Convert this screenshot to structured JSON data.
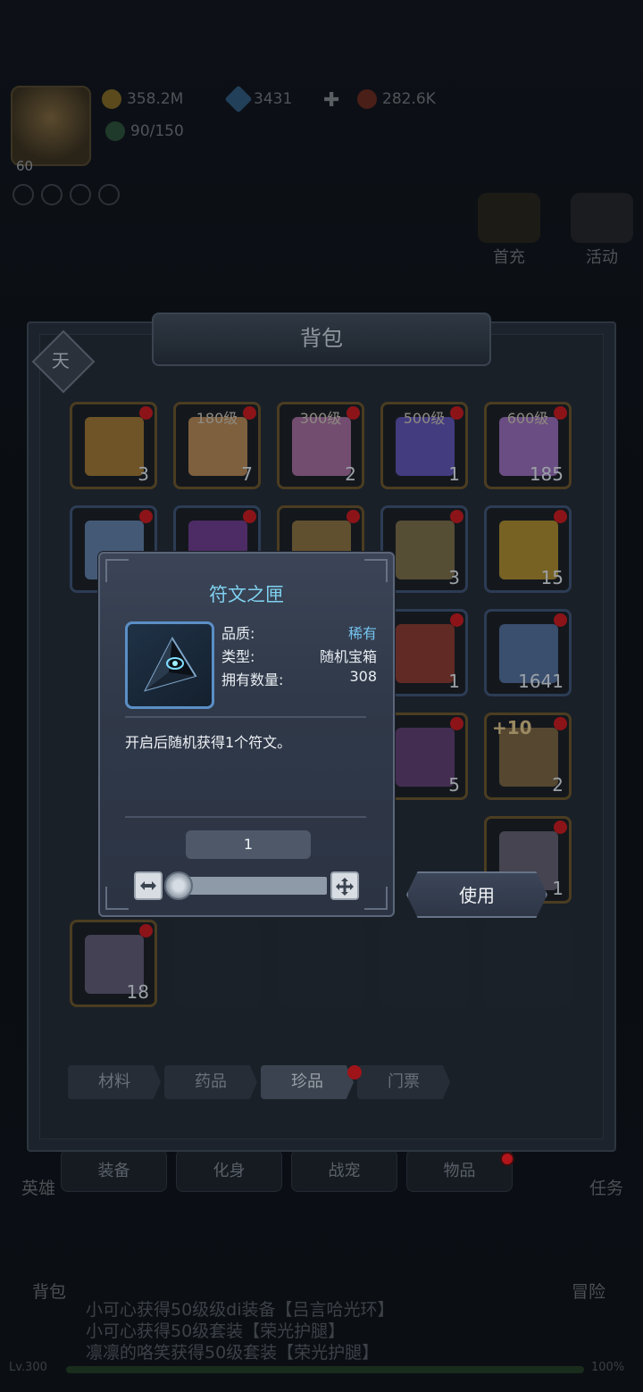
{
  "hud": {
    "player_level": "60",
    "gold": "358.2M",
    "diamonds": "3431",
    "crystal": "282.6K",
    "stamina": "90/150"
  },
  "side_buttons": {
    "first_charge": "首充",
    "activity": "活动",
    "hero": "英雄",
    "task": "任务",
    "bag": "背包",
    "adventure": "冒险"
  },
  "bag": {
    "title": "背包",
    "badge": "天",
    "slots": [
      {
        "tag": "",
        "plus": "",
        "count": "3",
        "art": "#b8862f",
        "border": "gold"
      },
      {
        "tag": "180级",
        "plus": "",
        "count": "7",
        "art": "#d69a5a",
        "border": "gold"
      },
      {
        "tag": "300级",
        "plus": "",
        "count": "2",
        "art": "#c07ab4",
        "border": "gold"
      },
      {
        "tag": "500级",
        "plus": "",
        "count": "1",
        "art": "#6a5bd0",
        "border": "gold"
      },
      {
        "tag": "600级",
        "plus": "",
        "count": "185",
        "art": "#b17ad6",
        "border": "gold"
      },
      {
        "tag": "",
        "plus": "",
        "count": "",
        "art": "#6b8fc0",
        "border": "blue"
      },
      {
        "tag": "",
        "plus": "",
        "count": "",
        "art": "#7c3da0",
        "border": "blue"
      },
      {
        "tag": "",
        "plus": "",
        "count": "",
        "art": "#a08040",
        "border": "gold"
      },
      {
        "tag": "",
        "plus": "",
        "count": "3",
        "art": "#8c7a48",
        "border": "blue"
      },
      {
        "tag": "",
        "plus": "",
        "count": "15",
        "art": "#c9a02a",
        "border": "blue"
      },
      {
        "tag": "",
        "plus": "",
        "count": "1",
        "art": "#a03a2a",
        "border": "blue"
      },
      {
        "tag": "",
        "plus": "",
        "count": "1641",
        "art": "#5a7cb0",
        "border": "blue"
      },
      {
        "tag": "",
        "plus": "",
        "count": "5",
        "art": "#6a3f7c",
        "border": "gold"
      },
      {
        "tag": "",
        "plus": "+10",
        "count": "2",
        "art": "#8a7040",
        "border": "gold"
      },
      {
        "tag": "",
        "plus": "",
        "count": "1",
        "art": "#6d6a7a",
        "border": "gold"
      },
      {
        "tag": "",
        "plus": "",
        "count": "18",
        "art": "#6a6480",
        "border": "gold"
      }
    ],
    "category_tabs": [
      "材料",
      "药品",
      "珍品",
      "门票"
    ],
    "active_tab": 2
  },
  "bottom_tabs": [
    "装备",
    "化身",
    "战宠",
    "物品"
  ],
  "dialog": {
    "title": "符文之匣",
    "quality_label": "品质:",
    "quality_value": "稀有",
    "type_label": "类型:",
    "type_value": "随机宝箱",
    "owned_label": "拥有数量:",
    "owned_value": "308",
    "description": "开启后随机获得1个符文。",
    "quantity": "1",
    "slider_fraction": 0.0
  },
  "use_button": "使用",
  "chat": [
    "小可心获得50级级di装备【吕言哈光环】",
    "小可心获得50级套装【荣光护腿】",
    "凛凛的咯笑获得50级套装【荣光护腿】"
  ],
  "exp": {
    "level": "Lv.300",
    "percent": "100%"
  }
}
